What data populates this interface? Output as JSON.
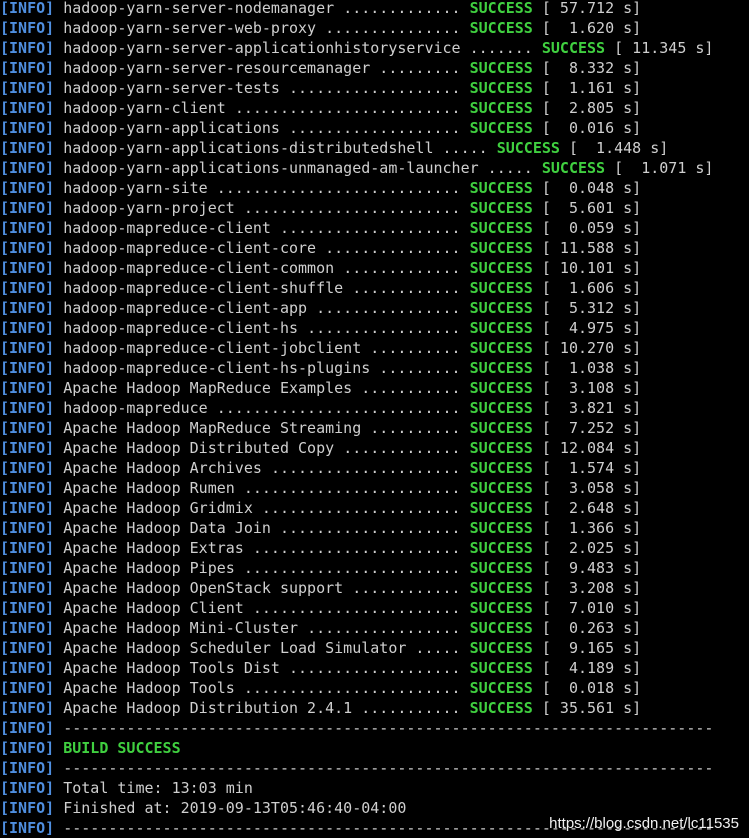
{
  "tag": "[INFO]",
  "modules": [
    {
      "name": "hadoop-yarn-server-nodemanager",
      "dots": ".............",
      "status": "SUCCESS",
      "time": "[ 57.712 s]"
    },
    {
      "name": "hadoop-yarn-server-web-proxy",
      "dots": "...............",
      "status": "SUCCESS",
      "time": "[  1.620 s]"
    },
    {
      "name": "hadoop-yarn-server-applicationhistoryservice",
      "dots": ".......",
      "status": "SUCCESS",
      "time": "[ 11.345 s]"
    },
    {
      "name": "hadoop-yarn-server-resourcemanager",
      "dots": ".........",
      "status": "SUCCESS",
      "time": "[  8.332 s]"
    },
    {
      "name": "hadoop-yarn-server-tests",
      "dots": "...................",
      "status": "SUCCESS",
      "time": "[  1.161 s]"
    },
    {
      "name": "hadoop-yarn-client",
      "dots": ".........................",
      "status": "SUCCESS",
      "time": "[  2.805 s]"
    },
    {
      "name": "hadoop-yarn-applications",
      "dots": "...................",
      "status": "SUCCESS",
      "time": "[  0.016 s]"
    },
    {
      "name": "hadoop-yarn-applications-distributedshell",
      "dots": ".....",
      "status": "SUCCESS",
      "time": "[  1.448 s]"
    },
    {
      "name": "hadoop-yarn-applications-unmanaged-am-launcher",
      "dots": ".....",
      "status": "SUCCESS",
      "time": "[  1.071 s]"
    },
    {
      "name": "hadoop-yarn-site",
      "dots": "...........................",
      "status": "SUCCESS",
      "time": "[  0.048 s]"
    },
    {
      "name": "hadoop-yarn-project",
      "dots": "........................",
      "status": "SUCCESS",
      "time": "[  5.601 s]"
    },
    {
      "name": "hadoop-mapreduce-client",
      "dots": "....................",
      "status": "SUCCESS",
      "time": "[  0.059 s]"
    },
    {
      "name": "hadoop-mapreduce-client-core",
      "dots": "...............",
      "status": "SUCCESS",
      "time": "[ 11.588 s]"
    },
    {
      "name": "hadoop-mapreduce-client-common",
      "dots": ".............",
      "status": "SUCCESS",
      "time": "[ 10.101 s]"
    },
    {
      "name": "hadoop-mapreduce-client-shuffle",
      "dots": "............",
      "status": "SUCCESS",
      "time": "[  1.606 s]"
    },
    {
      "name": "hadoop-mapreduce-client-app",
      "dots": "................",
      "status": "SUCCESS",
      "time": "[  5.312 s]"
    },
    {
      "name": "hadoop-mapreduce-client-hs",
      "dots": ".................",
      "status": "SUCCESS",
      "time": "[  4.975 s]"
    },
    {
      "name": "hadoop-mapreduce-client-jobclient",
      "dots": "..........",
      "status": "SUCCESS",
      "time": "[ 10.270 s]"
    },
    {
      "name": "hadoop-mapreduce-client-hs-plugins",
      "dots": ".........",
      "status": "SUCCESS",
      "time": "[  1.038 s]"
    },
    {
      "name": "Apache Hadoop MapReduce Examples",
      "dots": "...........",
      "status": "SUCCESS",
      "time": "[  3.108 s]"
    },
    {
      "name": "hadoop-mapreduce",
      "dots": "...........................",
      "status": "SUCCESS",
      "time": "[  3.821 s]"
    },
    {
      "name": "Apache Hadoop MapReduce Streaming",
      "dots": "..........",
      "status": "SUCCESS",
      "time": "[  7.252 s]"
    },
    {
      "name": "Apache Hadoop Distributed Copy",
      "dots": ".............",
      "status": "SUCCESS",
      "time": "[ 12.084 s]"
    },
    {
      "name": "Apache Hadoop Archives",
      "dots": ".....................",
      "status": "SUCCESS",
      "time": "[  1.574 s]"
    },
    {
      "name": "Apache Hadoop Rumen",
      "dots": "........................",
      "status": "SUCCESS",
      "time": "[  3.058 s]"
    },
    {
      "name": "Apache Hadoop Gridmix",
      "dots": "......................",
      "status": "SUCCESS",
      "time": "[  2.648 s]"
    },
    {
      "name": "Apache Hadoop Data Join",
      "dots": "....................",
      "status": "SUCCESS",
      "time": "[  1.366 s]"
    },
    {
      "name": "Apache Hadoop Extras",
      "dots": ".......................",
      "status": "SUCCESS",
      "time": "[  2.025 s]"
    },
    {
      "name": "Apache Hadoop Pipes",
      "dots": "........................",
      "status": "SUCCESS",
      "time": "[  9.483 s]"
    },
    {
      "name": "Apache Hadoop OpenStack support",
      "dots": "............",
      "status": "SUCCESS",
      "time": "[  3.208 s]"
    },
    {
      "name": "Apache Hadoop Client",
      "dots": ".......................",
      "status": "SUCCESS",
      "time": "[  7.010 s]"
    },
    {
      "name": "Apache Hadoop Mini-Cluster",
      "dots": ".................",
      "status": "SUCCESS",
      "time": "[  0.263 s]"
    },
    {
      "name": "Apache Hadoop Scheduler Load Simulator",
      "dots": ".....",
      "status": "SUCCESS",
      "time": "[  9.165 s]"
    },
    {
      "name": "Apache Hadoop Tools Dist",
      "dots": "...................",
      "status": "SUCCESS",
      "time": "[  4.189 s]"
    },
    {
      "name": "Apache Hadoop Tools",
      "dots": "........................",
      "status": "SUCCESS",
      "time": "[  0.018 s]"
    },
    {
      "name": "Apache Hadoop Distribution 2.4.1",
      "dots": "...........",
      "status": "SUCCESS",
      "time": "[ 35.561 s]"
    }
  ],
  "separator": "------------------------------------------------------------------------",
  "build_result": "BUILD SUCCESS",
  "total_time": "Total time: 13:03 min",
  "finished_at": "Finished at: 2019-09-13T05:46:40-04:00",
  "watermark": "https://blog.csdn.net/lc11535"
}
